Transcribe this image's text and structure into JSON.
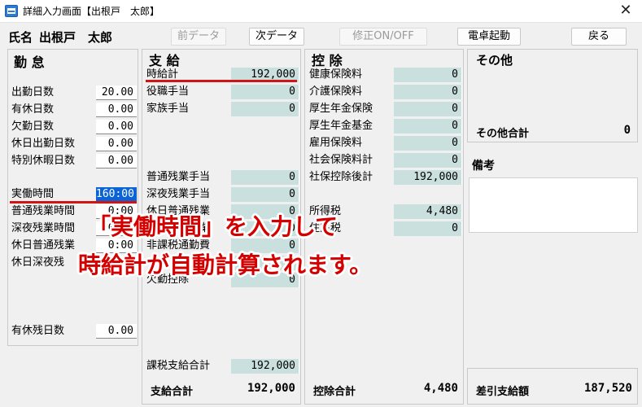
{
  "window": {
    "title": "詳細入力画面【出根戸　太郎】",
    "close": "✕"
  },
  "toolbar": {
    "name_label": "氏名",
    "name_value": "出根戸　太郎",
    "prev_label": "前データ",
    "next_label": "次データ",
    "edit_label": "修正ON/OFF",
    "calc_label": "電卓起動",
    "back_label": "戻る"
  },
  "attendance": {
    "title": "勤 怠",
    "items": [
      {
        "label": "出勤日数",
        "value": "20.00"
      },
      {
        "label": "有休日数",
        "value": "0.00"
      },
      {
        "label": "欠勤日数",
        "value": "0.00"
      },
      {
        "label": "休日出勤日数",
        "value": "0.00"
      },
      {
        "label": "特別休暇日数",
        "value": "0.00"
      }
    ],
    "hours": [
      {
        "label": "実働時間",
        "value": "160:00"
      },
      {
        "label": "普通残業時間",
        "value": "0:00"
      },
      {
        "label": "深夜残業時間",
        "value": "0:00"
      },
      {
        "label": "休日普通残業",
        "value": "0:00"
      },
      {
        "label": "休日深夜残",
        "value": ""
      }
    ],
    "paid_leave_remaining": {
      "label": "有休残日数",
      "value": "0.00"
    }
  },
  "payments": {
    "title": "支 給",
    "items": [
      {
        "label": "時給計",
        "value": "192,000"
      },
      {
        "label": "役職手当",
        "value": "0"
      },
      {
        "label": "家族手当",
        "value": "0"
      }
    ],
    "lower": [
      {
        "label": "普通残業手当",
        "value": "0"
      },
      {
        "label": "深夜残業手当",
        "value": "0"
      },
      {
        "label": "休日普通残業",
        "value": "0"
      },
      {
        "label": "休日深夜残業",
        "value": "0"
      },
      {
        "label": "非課税通勤費",
        "value": "0"
      },
      {
        "label": "",
        "value": "0"
      },
      {
        "label": "欠勤控除",
        "value": "0"
      }
    ],
    "taxable_total": {
      "label": "課税支給合計",
      "value": "192,000"
    },
    "total": {
      "label": "支給合計",
      "value": "192,000"
    }
  },
  "deductions": {
    "title": "控 除",
    "items": [
      {
        "label": "健康保険料",
        "value": "0"
      },
      {
        "label": "介護保険料",
        "value": "0"
      },
      {
        "label": "厚生年金保険",
        "value": "0"
      },
      {
        "label": "厚生年金基金",
        "value": "0"
      },
      {
        "label": "雇用保険料",
        "value": "0"
      },
      {
        "label": "社会保険料計",
        "value": "0"
      },
      {
        "label": "社保控除後計",
        "value": "192,000"
      }
    ],
    "tax": [
      {
        "label": "所得税",
        "value": "4,480"
      },
      {
        "label": "住民税",
        "value": "0"
      }
    ],
    "total": {
      "label": "控除合計",
      "value": "4,480"
    }
  },
  "other": {
    "title": "その他",
    "total": {
      "label": "その他合計",
      "value": "0"
    },
    "remarks_label": "備考",
    "net_pay": {
      "label": "差引支給額",
      "value": "187,520"
    }
  },
  "annotation": {
    "line1": "「実働時間」を入力して",
    "line2": "時給計が自動計算されます。"
  },
  "colors": {
    "highlight": "#d11515",
    "selection": "#0a64d6",
    "readonly_field": "#c9e0df"
  }
}
